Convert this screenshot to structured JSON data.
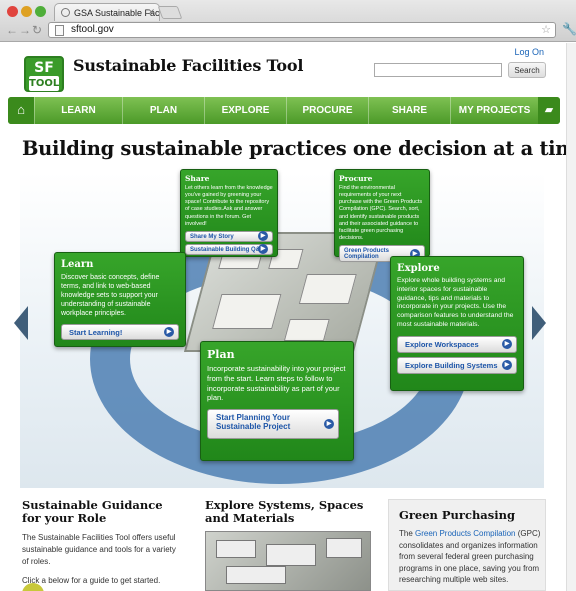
{
  "browser": {
    "tab_title": "GSA Sustainable Facilites To",
    "tab_close": "✕",
    "url": "sftool.gov",
    "back": "←",
    "forward": "→",
    "reload": "↻",
    "star": "☆",
    "menu": "🔧"
  },
  "logo": {
    "line1": "SF",
    "line2": "TOOL"
  },
  "site_title": "Sustainable Facilities Tool",
  "log_on": "Log On",
  "search": {
    "placeholder": "",
    "button": "Search"
  },
  "nav": {
    "home": "⌂",
    "items": [
      "LEARN",
      "PLAN",
      "EXPLORE",
      "PROCURE",
      "SHARE",
      "MY PROJECTS"
    ],
    "folder": "▰"
  },
  "headline": "Building sustainable practices one decision at a time",
  "carousel": {
    "prev": "◀",
    "next": "▶"
  },
  "share": {
    "title": "Share",
    "text": "Let others learn from the knowledge you've gained by greening your space! Contribute to the repository of case studies.Ask and answer questions in the forum. Get involved!",
    "buttons": [
      "Share My Story",
      "Sustainable Building Q&A"
    ]
  },
  "procure": {
    "title": "Procure",
    "text": "Find the environmental requirements of your next purchase with the Green Products Compilation (GPC). Search, sort, and identify sustainable products and their associated guidance to facilitate green purchasing decisions.",
    "button": "Green Products Compilation"
  },
  "learn": {
    "title": "Learn",
    "text": "Discover basic concepts, define terms, and link to web-based knowledge sets to support your understanding of sustainable workplace principles.",
    "button": "Start Learning!"
  },
  "explore": {
    "title": "Explore",
    "text": "Explore whole building systems and interior spaces for sustainable guidance, tips and materials to incorporate in your projects. Use the comparison features to understand the most sustainable materials.",
    "buttons": [
      "Explore Workspaces",
      "Explore Building Systems"
    ]
  },
  "plan": {
    "title": "Plan",
    "text": "Incorporate sustainability into your project from the start. Learn steps to follow to incorporate sustainability as part of your plan.",
    "button": "Start Planning Your Sustainable Project"
  },
  "guidance": {
    "title": "Sustainable Guidance for your Role",
    "text": "The Sustainable Facilities Tool offers useful sustainable guidance and tools for a variety of roles.",
    "text2": "Click a below for a guide to get started."
  },
  "systems": {
    "title": "Explore Systems, Spaces and Materials"
  },
  "green": {
    "title": "Green Purchasing",
    "pre": "The ",
    "link": "Green Products Compilation",
    "text": " (GPC) consolidates and organizes information from several federal green purchasing programs in one place, saving you from researching multiple web sites."
  },
  "colors": {
    "brand_green": "#3a9b2a",
    "nav_green": "#6ab343",
    "ring_blue": "#4d7fb3",
    "link_blue": "#1a64b8"
  }
}
